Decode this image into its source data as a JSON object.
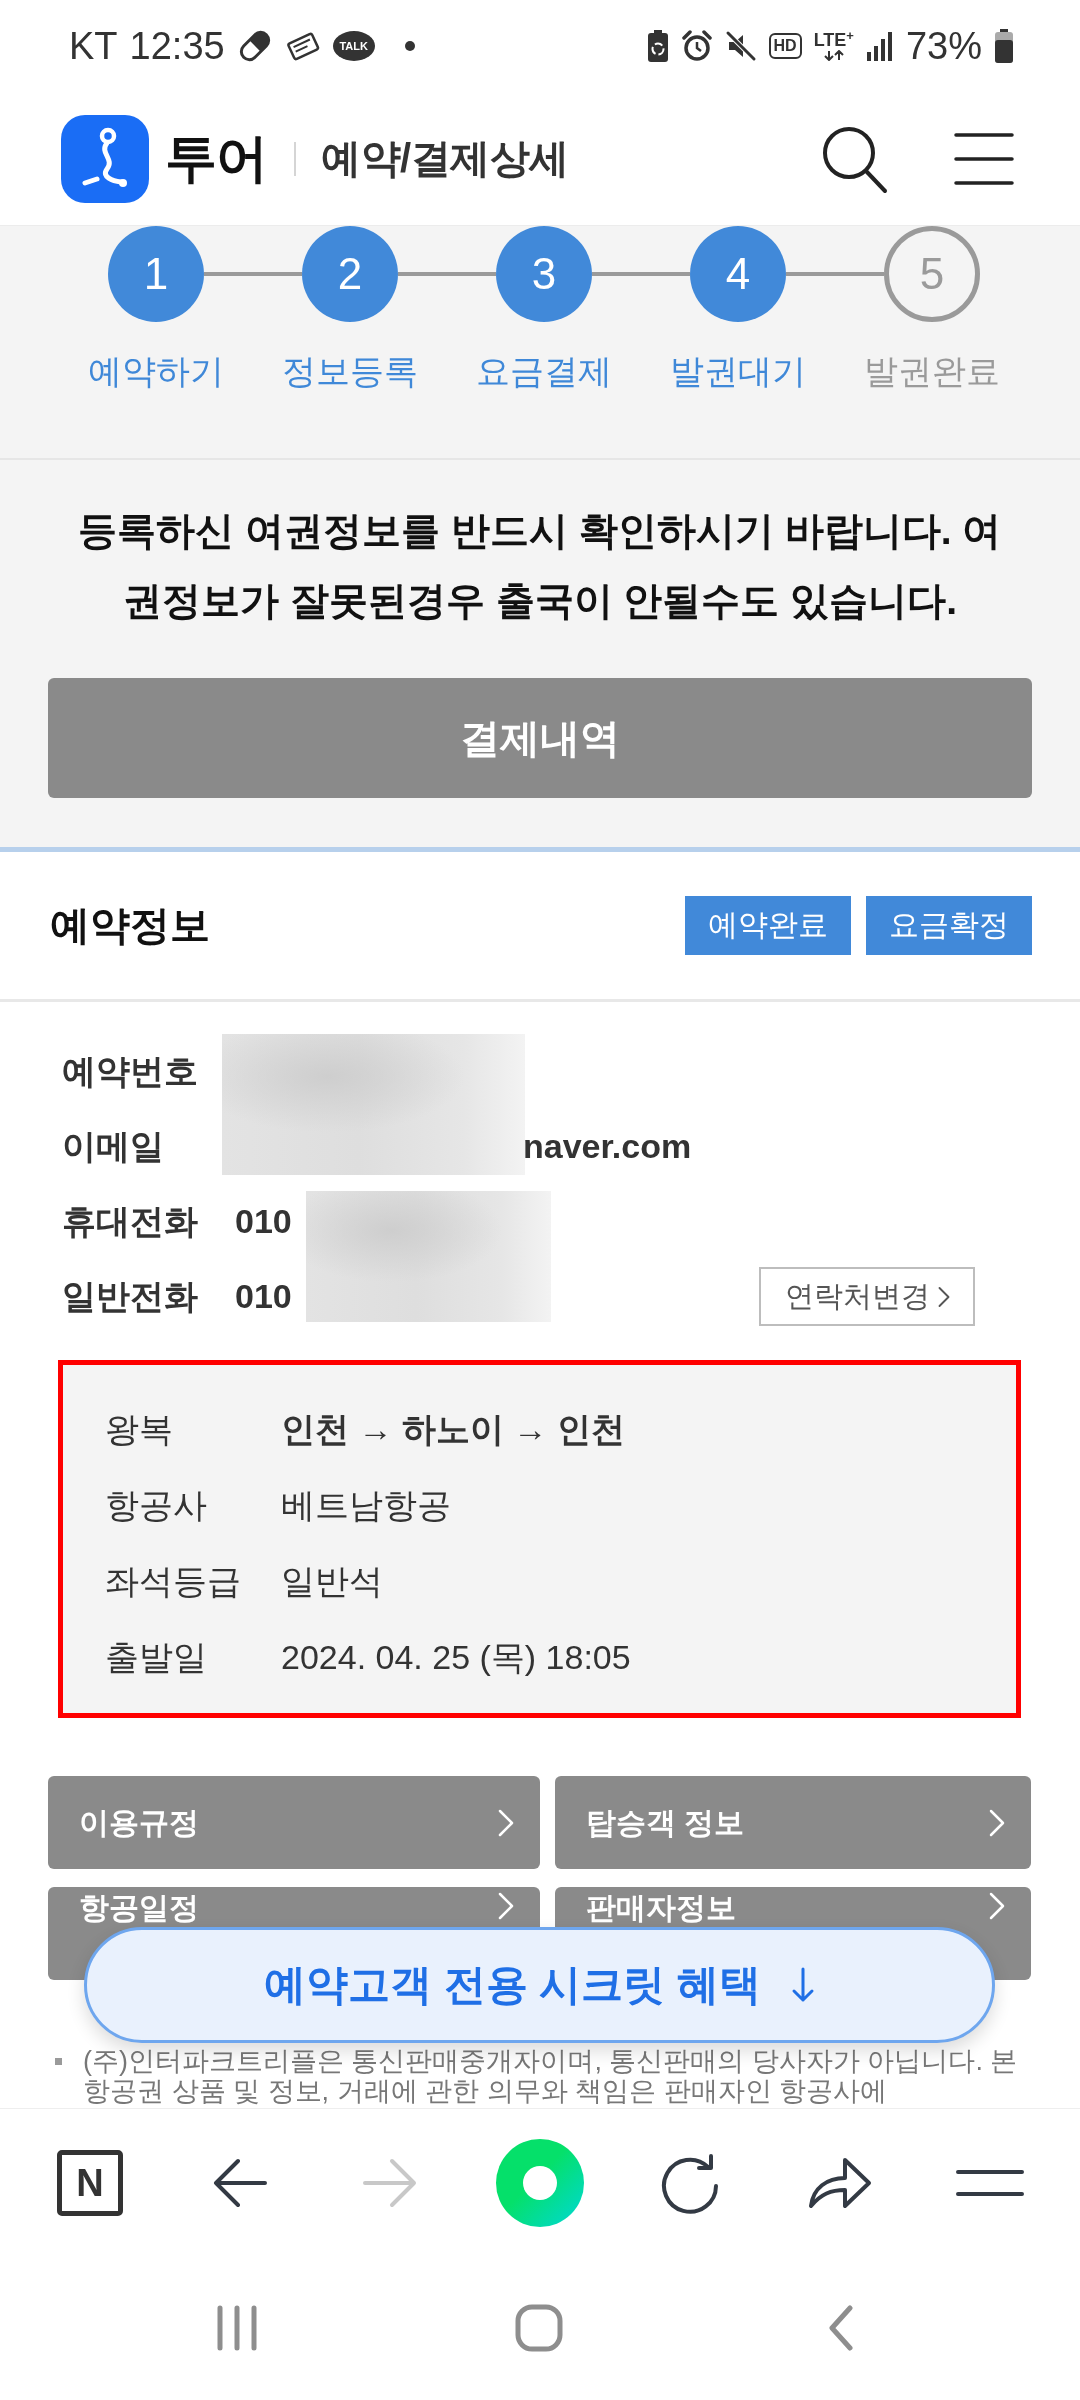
{
  "status_bar": {
    "carrier": "KT",
    "time": "12:35",
    "chat_badge": "TALK",
    "hd_label": "HD",
    "network_label": "LTE$^{+}$",
    "battery": "73%"
  },
  "header": {
    "brand": "투어",
    "title": "예약/결제상세"
  },
  "steps": [
    {
      "number": "1",
      "label": "예약하기",
      "completed": true
    },
    {
      "number": "2",
      "label": "정보등록",
      "completed": true
    },
    {
      "number": "3",
      "label": "요금결제",
      "completed": true
    },
    {
      "number": "4",
      "label": "발권대기",
      "completed": true
    },
    {
      "number": "5",
      "label": "발권완료",
      "completed": false
    }
  ],
  "notice": "등록하신 여권정보를 반드시 확인하시기 바랍니다. 여권정보가 잘못된경우 출국이 안될수도 있습니다.",
  "payment_button": "결제내역",
  "reservation": {
    "title": "예약정보",
    "badges": [
      "예약완료",
      "요금확정"
    ],
    "contacts": [
      {
        "label": "예약번호"
      },
      {
        "label": "이메일",
        "value": "naver.com"
      },
      {
        "label": "휴대전화",
        "value": "010"
      },
      {
        "label": "일반전화",
        "value": "010"
      }
    ],
    "change_contact_button": "연락처변경"
  },
  "flight": [
    {
      "label": "왕복",
      "value": "**인천** → **하노이** → **인천**"
    },
    {
      "label": "항공사",
      "value": "베트남항공"
    },
    {
      "label": "좌석등급",
      "value": "일반석"
    },
    {
      "label": "출발일",
      "value": "2024. 04. 25 (목) 18:05"
    }
  ],
  "menu_buttons": [
    "이용규정",
    "탑승객 정보",
    "항공일정",
    "판매자정보"
  ],
  "footnote": "(주)인터파크트리플은 통신판매중개자이며, 통신판매의 당사자가 아닙니다. 본 항공권 상품 및 정보, 거래에 관한 의무와 책임은 판매자인 항공사에",
  "promo_button": "예약고객 전용 시크릿 혜택",
  "browser_toolbar": {
    "home_label": "N",
    "forward_disabled": true
  }
}
